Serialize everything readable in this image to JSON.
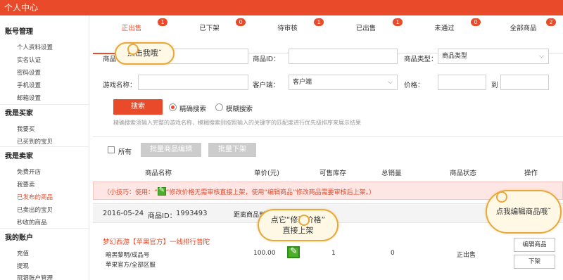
{
  "window": {
    "title": "个人中心"
  },
  "sidebar": {
    "sections": [
      {
        "title": "账号管理",
        "items": [
          "个人资料设置",
          "实名认证",
          "密码设置",
          "手机设置",
          "邮箱设置"
        ]
      },
      {
        "title": "我是买家",
        "items": [
          "我要买",
          "已买到的宝贝"
        ]
      },
      {
        "title": "我是卖家",
        "items": [
          "免费开店",
          "我要卖",
          "已发布的商品",
          "已卖出的宝贝",
          "秒收的商品"
        ]
      },
      {
        "title": "我的账户",
        "items": [
          "充值",
          "提现",
          "冠银账户管理"
        ]
      }
    ],
    "active_item": "已发布的商品"
  },
  "tabs": [
    {
      "label": "正出售",
      "badge": "1",
      "active": true
    },
    {
      "label": "已下架",
      "badge": "0"
    },
    {
      "label": "待审核",
      "badge": "1"
    },
    {
      "label": "已出售",
      "badge": "1"
    },
    {
      "label": "未通过",
      "badge": "0"
    },
    {
      "label": "全部商品",
      "badge": "2"
    }
  ],
  "search": {
    "product_name_label": "商品",
    "product_id_label": "商品ID：",
    "product_type_label": "商品类型：",
    "product_type_value": "商品类型",
    "game_name_label": "游戏名称：",
    "client_label": "客户端：",
    "client_value": "客户端",
    "price_label": "价格：",
    "price_to_label": "到",
    "search_button": "搜索",
    "exact_search": "精确搜索",
    "fuzzy_search": "模糊搜索",
    "hint": "精确搜索须输入完整的游戏名称，模糊搜索则按照输入的关键字的匹配度进行优先级排序来展示结果"
  },
  "toolbar": {
    "select_all": "所有",
    "batch_edit": "批量商品编辑",
    "batch_unlist": "批量下架"
  },
  "table": {
    "headers": [
      "商品名称",
      "单价(元)",
      "可售库存",
      "总销量",
      "商品状态",
      "操作"
    ],
    "tip": {
      "prefix": "（小技巧：使用：“",
      "middle": "”修改价格无需审核直接上架，使用“编辑商品”修改商品需要审核后上架。）"
    },
    "order": {
      "date": "2016-05-24",
      "id_label": "商品ID：",
      "id": "1993493",
      "distance": "距离商品到期"
    },
    "row": {
      "title": "梦幻西游【苹果官方】一线排行普陀",
      "sub1": "暗黑黎明/成品号",
      "sub2": "苹果官方/全部区服",
      "price": "100.00",
      "stock": "1",
      "sales": "0",
      "status": "正出售",
      "edit_button": "编辑商品",
      "unlist_button": "下架"
    }
  },
  "clouds": {
    "click_me": "点击我哦˘",
    "modify_price_line1": "点它“修改价格”",
    "modify_price_line2": "直接上架",
    "edit_me": "点我编辑商品哦˘"
  },
  "colors": {
    "accent": "#e84a2a",
    "cloud_border": "#e9a83a",
    "edit_green": "#4caf2a"
  }
}
